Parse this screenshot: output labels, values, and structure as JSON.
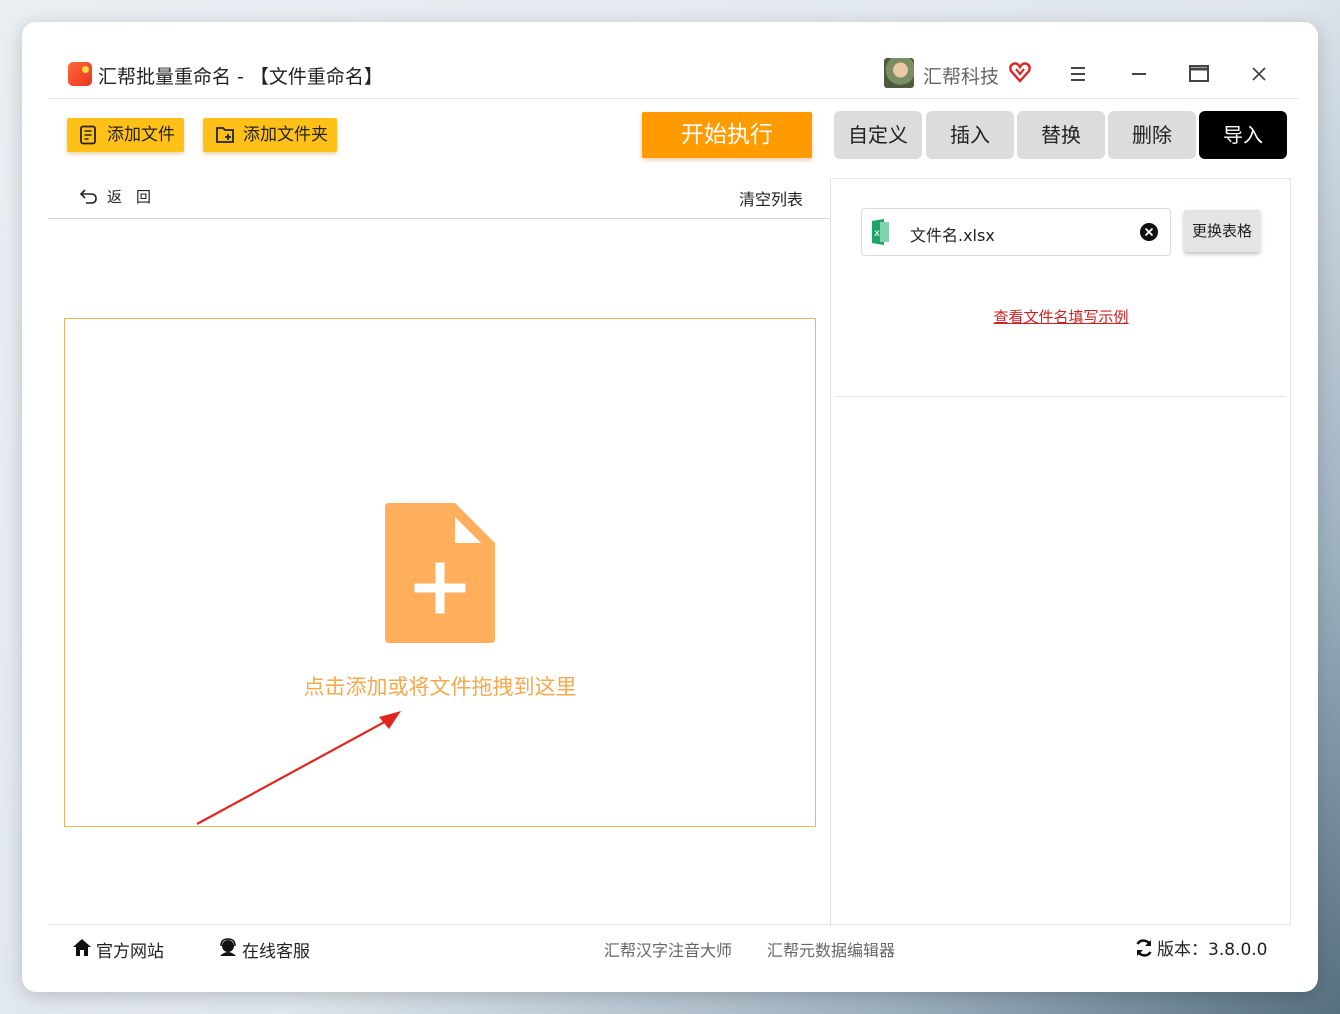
{
  "window": {
    "title": "汇帮批量重命名 - 【文件重命名】",
    "company": "汇帮科技"
  },
  "toolbar": {
    "add_file": "添加文件",
    "add_folder": "添加文件夹",
    "start": "开始执行",
    "tabs": [
      {
        "label": "自定义",
        "active": false
      },
      {
        "label": "插入",
        "active": false
      },
      {
        "label": "替换",
        "active": false
      },
      {
        "label": "删除",
        "active": false
      },
      {
        "label": "导入",
        "active": true
      }
    ]
  },
  "left_panel": {
    "back": "返回",
    "clear_list": "清空列表",
    "drop_text": "点击添加或将文件拖拽到这里"
  },
  "right_panel": {
    "file_name": "文件名.xlsx",
    "change_table": "更换表格",
    "example_link": "查看文件名填写示例"
  },
  "footer": {
    "website": "官方网站",
    "service": "在线客服",
    "link1": "汇帮汉字注音大师",
    "link2": "汇帮元数据编辑器",
    "version": "版本：3.8.0.0"
  },
  "colors": {
    "accent_yellow": "#ffc017",
    "start_orange": "#ff9a00",
    "drop_orange": "#f5a94d",
    "link_red": "#d02020"
  }
}
